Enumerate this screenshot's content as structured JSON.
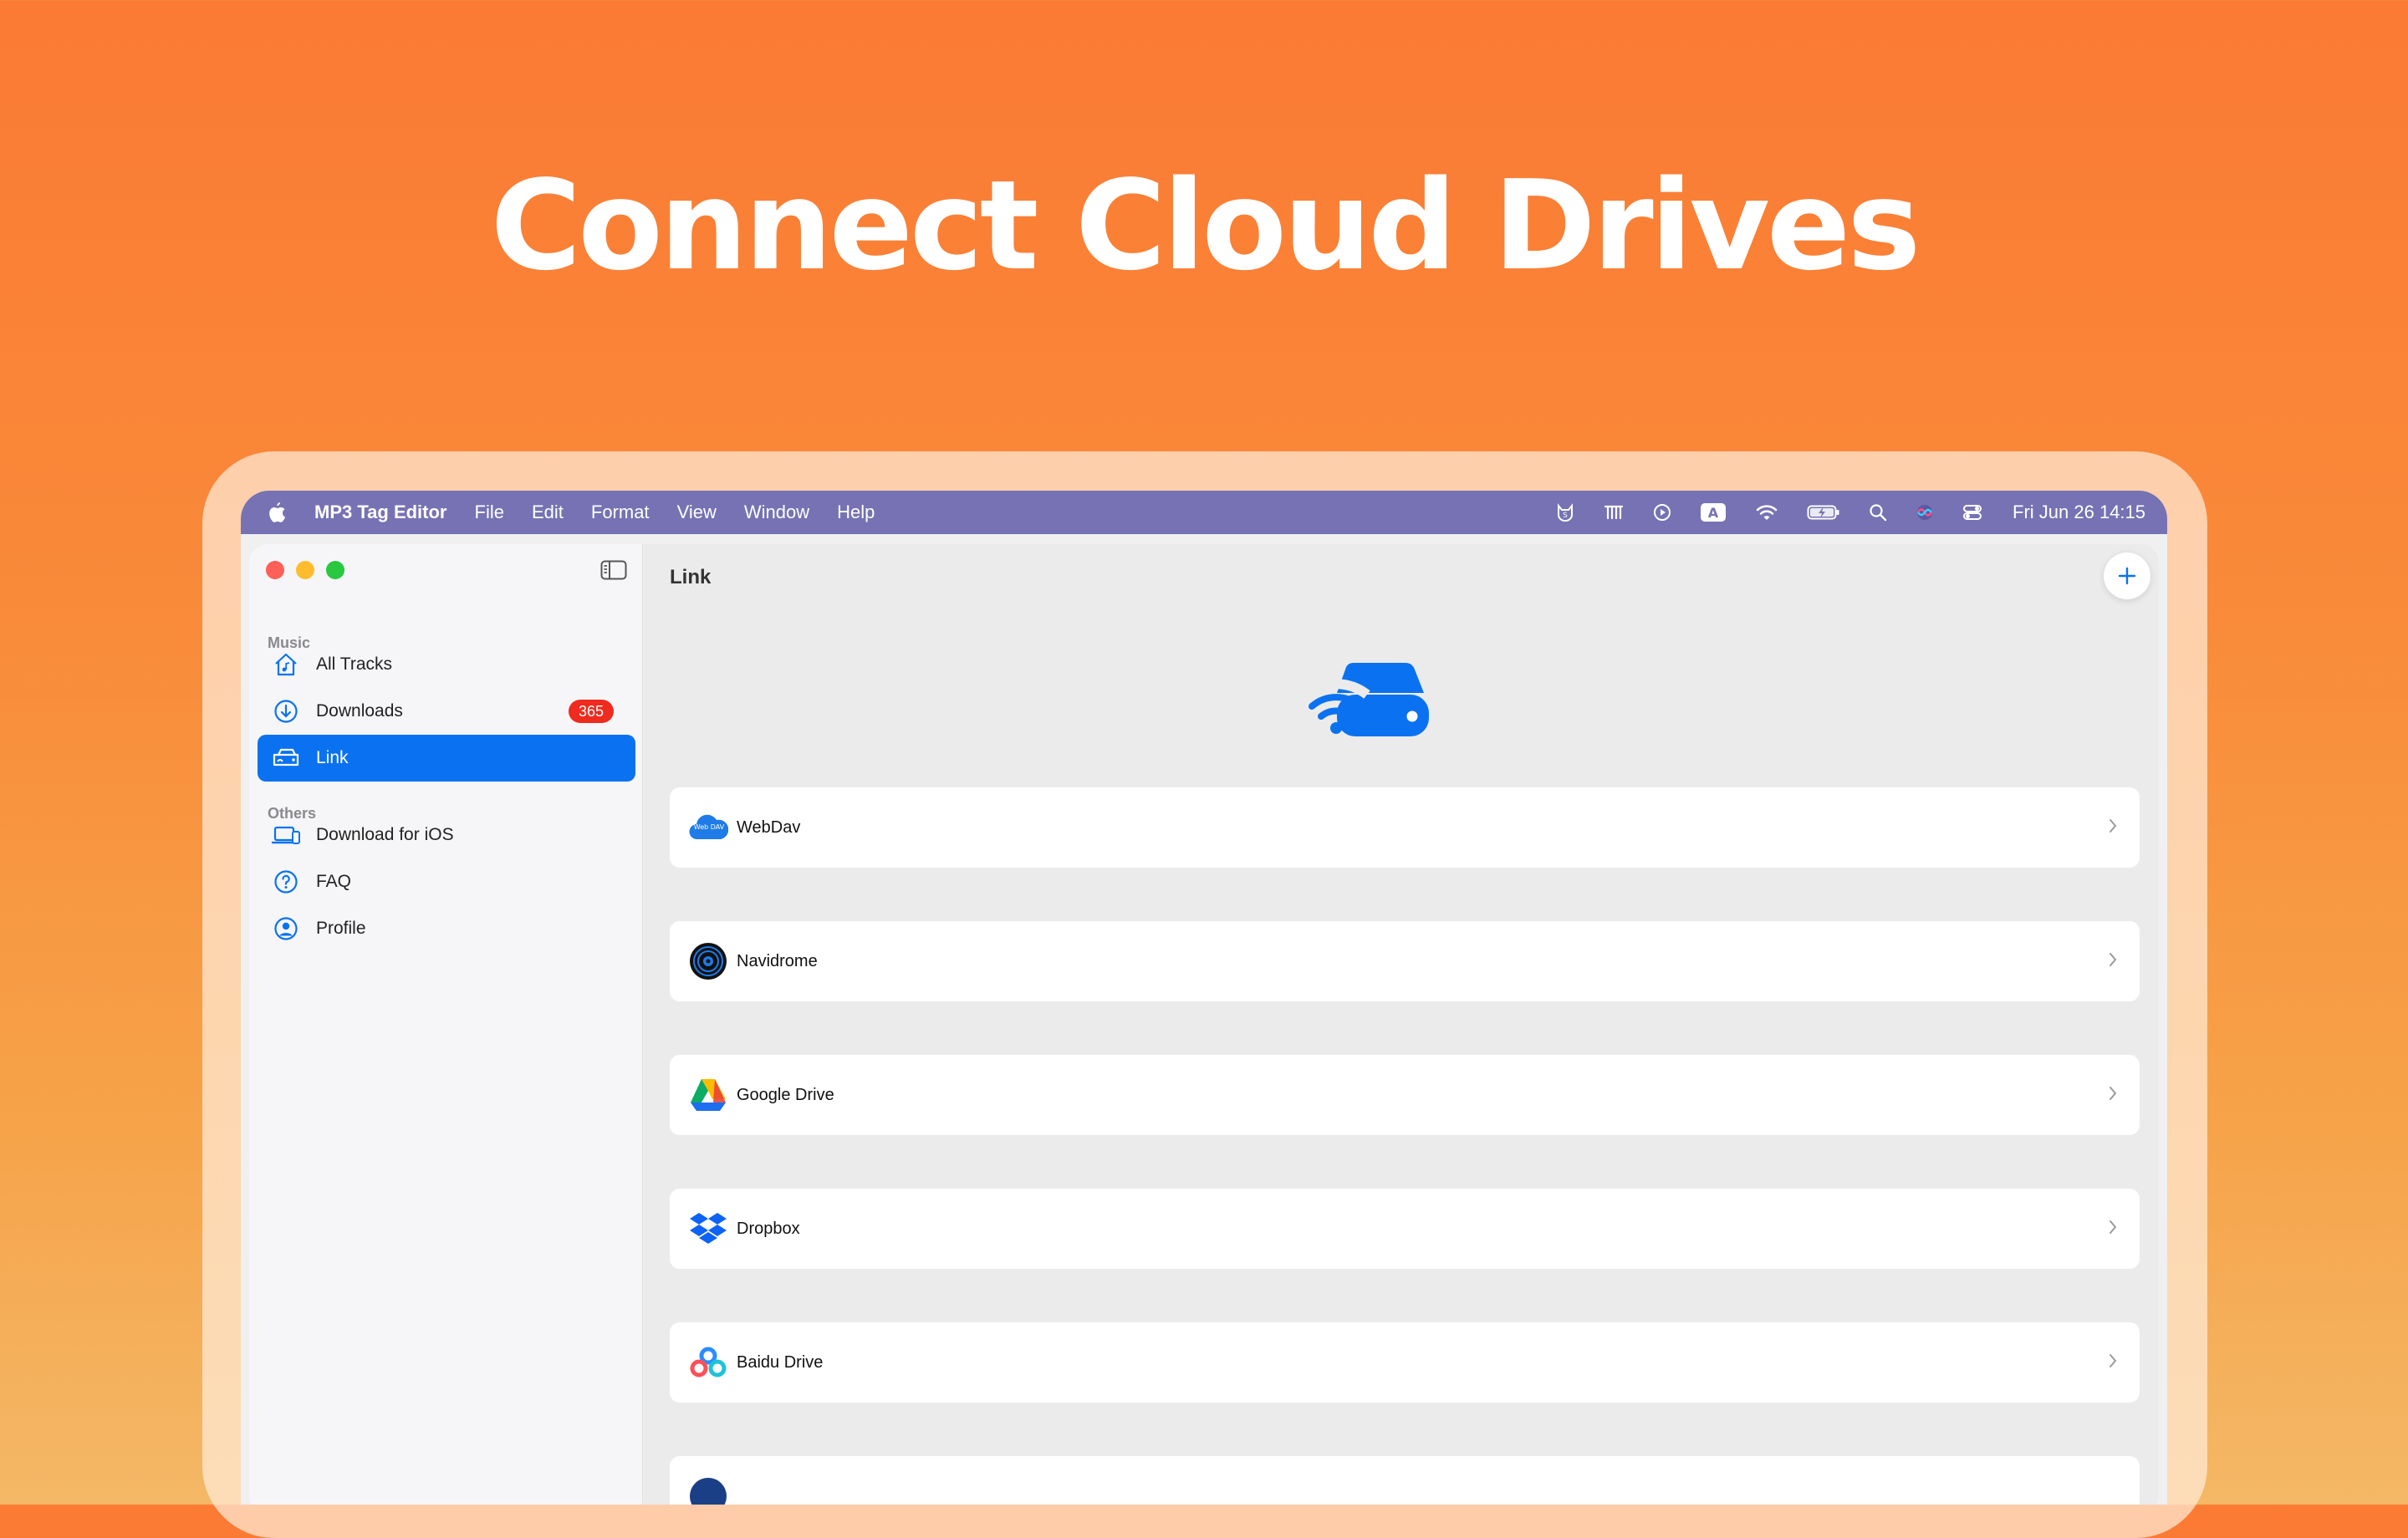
{
  "headline": "Connect Cloud Drives",
  "menubar": {
    "app_name": "MP3 Tag Editor",
    "menus": [
      "File",
      "Edit",
      "Format",
      "View",
      "Window",
      "Help"
    ],
    "status_icons": [
      "cat-icon",
      "shazam-icon",
      "play-icon",
      "input-source-icon",
      "wifi-icon",
      "battery-icon",
      "search-icon",
      "siri-icon",
      "control-center-icon"
    ],
    "input_source": "A",
    "clock": "Fri Jun 26  14:15"
  },
  "sidebar": {
    "section_music": "Music",
    "section_others": "Others",
    "items": [
      {
        "label": "All Tracks",
        "icon": "home-music-icon"
      },
      {
        "label": "Downloads",
        "icon": "download-circle-icon",
        "badge": "365"
      },
      {
        "label": "Link",
        "icon": "drive-link-icon",
        "active": true
      },
      {
        "label": "Download for iOS",
        "icon": "laptop-phone-icon"
      },
      {
        "label": "FAQ",
        "icon": "question-circle-icon"
      },
      {
        "label": "Profile",
        "icon": "person-circle-icon"
      }
    ]
  },
  "main": {
    "title": "Link",
    "hero_icon": "wifi-drive-icon",
    "services": [
      {
        "label": "WebDav",
        "icon": "webdav-icon",
        "logo_text": "Web DAV"
      },
      {
        "label": "Navidrome",
        "icon": "navidrome-icon"
      },
      {
        "label": "Google Drive",
        "icon": "google-drive-icon"
      },
      {
        "label": "Dropbox",
        "icon": "dropbox-icon"
      },
      {
        "label": "Baidu Drive",
        "icon": "baidu-drive-icon"
      }
    ]
  },
  "colors": {
    "accent": "#0a72f0",
    "badge": "#ee2b1e",
    "menubar": "#7672b3",
    "background_top": "#fb7a34",
    "background_bottom": "#f4b866"
  }
}
